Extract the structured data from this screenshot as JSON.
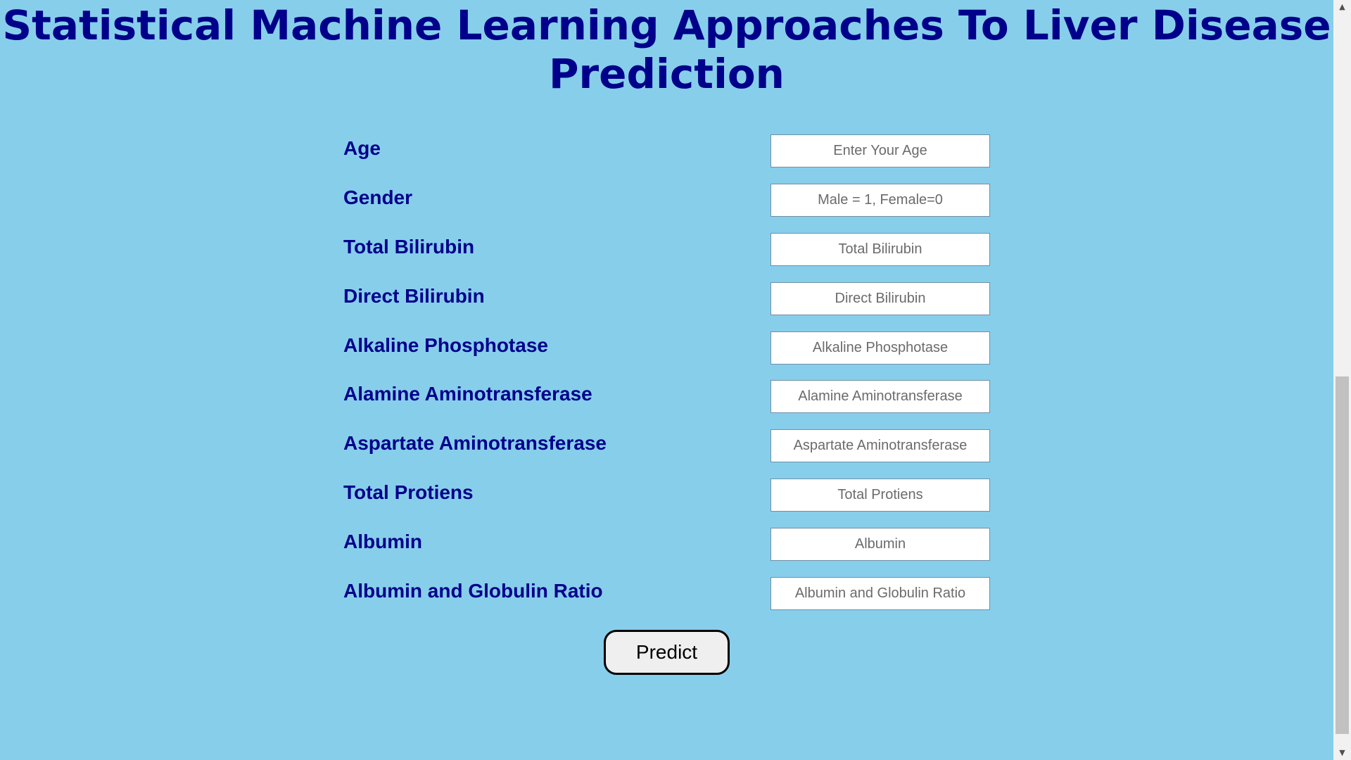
{
  "page": {
    "title": "Statistical Machine Learning Approaches To Liver Disease Prediction"
  },
  "form": {
    "fields": [
      {
        "label": "Age",
        "placeholder": "Enter Your Age",
        "value": ""
      },
      {
        "label": "Gender",
        "placeholder": "Male = 1, Female=0",
        "value": ""
      },
      {
        "label": "Total Bilirubin",
        "placeholder": "Total Bilirubin",
        "value": ""
      },
      {
        "label": "Direct Bilirubin",
        "placeholder": "Direct Bilirubin",
        "value": ""
      },
      {
        "label": "Alkaline Phosphotase",
        "placeholder": "Alkaline Phosphotase",
        "value": ""
      },
      {
        "label": "Alamine Aminotransferase",
        "placeholder": "Alamine Aminotransferase",
        "value": ""
      },
      {
        "label": "Aspartate Aminotransferase",
        "placeholder": "Aspartate Aminotransferase",
        "value": ""
      },
      {
        "label": "Total Protiens",
        "placeholder": "Total Protiens",
        "value": ""
      },
      {
        "label": "Albumin",
        "placeholder": "Albumin",
        "value": ""
      },
      {
        "label": "Albumin and Globulin Ratio",
        "placeholder": "Albumin and Globulin Ratio",
        "value": ""
      }
    ],
    "submit_label": "Predict"
  },
  "scrollbar": {
    "up_icon": "chevron-up-icon",
    "down_icon": "chevron-down-icon"
  },
  "colors": {
    "background": "#87ceeb",
    "heading": "#00008b",
    "input_background": "#ffffff",
    "button_background": "#efefef",
    "button_border": "#000000"
  }
}
